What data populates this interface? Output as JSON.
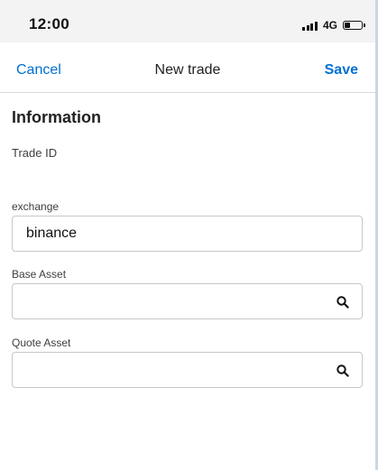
{
  "status_bar": {
    "time": "12:00",
    "network": "4G",
    "battery_level": 0.35
  },
  "header": {
    "cancel_label": "Cancel",
    "title": "New trade",
    "save_label": "Save"
  },
  "section": {
    "title": "Information"
  },
  "fields": {
    "trade_id": {
      "label": "Trade ID",
      "value": ""
    },
    "exchange": {
      "label": "exchange",
      "value": "binance"
    },
    "base_asset": {
      "label": "Base Asset",
      "value": "",
      "icon": "search-icon"
    },
    "quote_asset": {
      "label": "Quote Asset",
      "value": "",
      "icon": "search-icon"
    }
  },
  "colors": {
    "link": "#0070d2",
    "status_bar_bg": "#f3f3f3",
    "border": "#c9c7c5"
  }
}
